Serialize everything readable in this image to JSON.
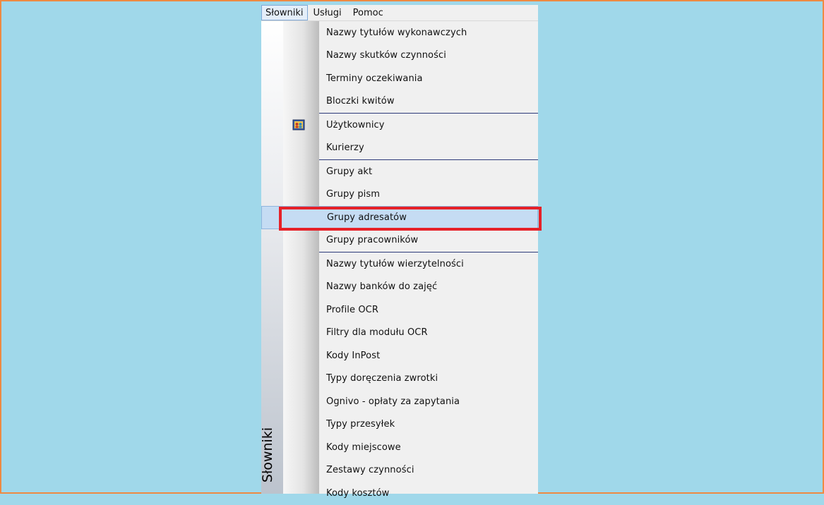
{
  "menubar": {
    "items": [
      {
        "label": "Słowniki",
        "active": true
      },
      {
        "label": "Usługi"
      },
      {
        "label": "Pomoc"
      }
    ]
  },
  "dropdown": {
    "side_label": "Słowniki",
    "groups": [
      [
        "Nazwy tytułów wykonawczych",
        "Nazwy skutków czynności",
        "Terminy oczekiwania",
        "Bloczki kwitów"
      ],
      [
        "Użytkownicy",
        "Kurierzy"
      ],
      [
        "Grupy akt",
        "Grupy pism",
        "Grupy adresatów",
        "Grupy pracowników"
      ],
      [
        "Nazwy tytułów wierzytelności",
        "Nazwy banków do zajęć",
        "Profile OCR",
        "Filtry dla modułu OCR",
        "Kody InPost",
        "Typy doręczenia zwrotki",
        "Ognivo - opłaty za zapytania",
        "Typy przesyłek",
        "Kody miejscowe",
        "Zestawy czynności",
        "Kody kosztów"
      ]
    ],
    "selected_item": "Grupy adresatów",
    "icon_item": "Użytkownicy",
    "icon_name": "users-icon"
  },
  "colors": {
    "background": "#a0d8ea",
    "frame": "#ee8a43",
    "highlight_box": "#e62128",
    "selection": "#c5dcf3"
  }
}
